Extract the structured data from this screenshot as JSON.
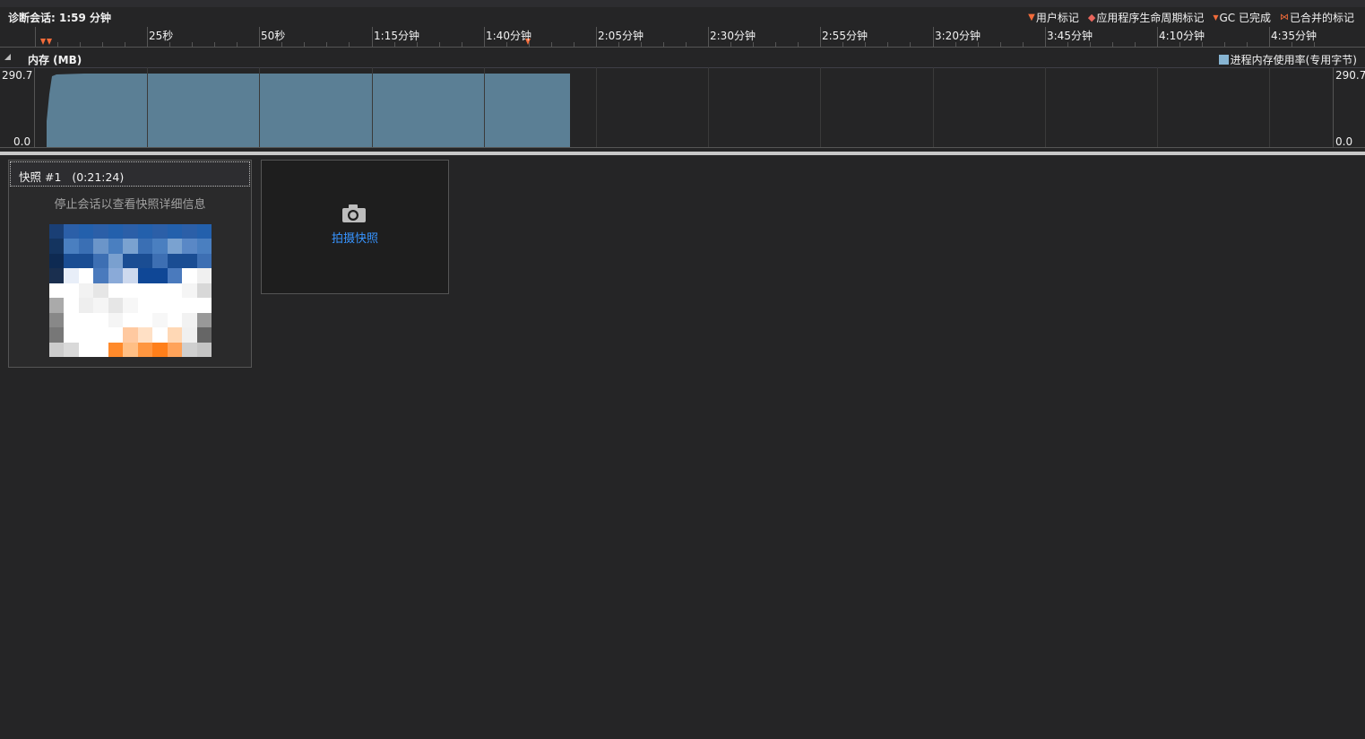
{
  "session": {
    "title": "诊断会话: 1:59 分钟"
  },
  "legend": {
    "items": [
      {
        "icon": "user-mark-icon",
        "glyph": "▼",
        "label": "用户标记"
      },
      {
        "icon": "lifecycle-mark-icon",
        "glyph": "◆",
        "label": "应用程序生命周期标记"
      },
      {
        "icon": "gc-mark-icon",
        "glyph": "▼",
        "label": "GC 已完成"
      },
      {
        "icon": "merged-mark-icon",
        "glyph": "⋈",
        "label": "已合并的标记"
      }
    ]
  },
  "ruler": {
    "labels": [
      "25秒",
      "50秒",
      "1:15分钟",
      "1:40分钟",
      "2:05分钟",
      "2:30分钟",
      "2:55分钟",
      "3:20分钟",
      "3:45分钟",
      "4:10分钟",
      "4:35分钟"
    ]
  },
  "memory": {
    "title": "内存 (MB)",
    "legend_label": "进程内存使用率(专用字节)",
    "series_color": "#5b7f95",
    "legend_color": "#87b4d2",
    "y_max_label": "290.7",
    "y_min_label": "0.0"
  },
  "snapshot": {
    "title": "快照 #1   (0:21:24)",
    "message": "停止会话以查看快照详细信息"
  },
  "take_snapshot": {
    "label": "拍摄快照"
  },
  "colors": {
    "background": "#252526",
    "accent_link": "#3794ff",
    "marker": "#f26b3a"
  }
}
